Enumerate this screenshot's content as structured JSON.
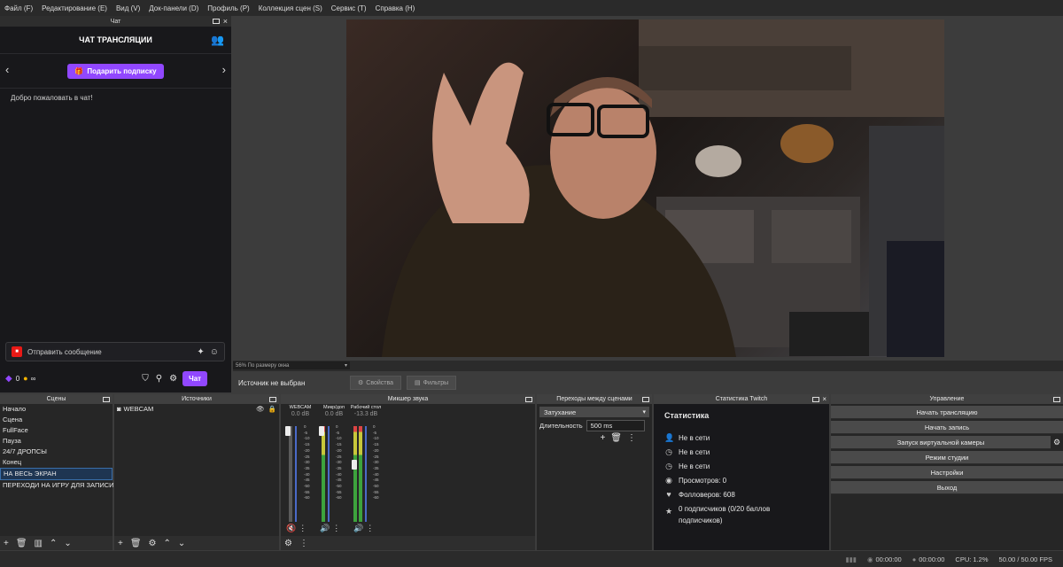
{
  "menu": [
    "Файл (F)",
    "Редактирование (E)",
    "Вид (V)",
    "Док-панели (D)",
    "Профиль (P)",
    "Коллекция сцен (S)",
    "Сервис (T)",
    "Справка (H)"
  ],
  "chat_dock": {
    "dock_title": "Чат",
    "header": "ЧАТ ТРАНСЛЯЦИИ",
    "gift_button": "Подарить подписку",
    "welcome": "Добро пожаловать в чат!",
    "message_placeholder": "Отправить сообщение",
    "points": "0",
    "infinity": "∞",
    "send_button": "Чат"
  },
  "preview": {
    "zoom_label": "56% По размеру окна"
  },
  "source_bar": {
    "label": "Источник не выбран",
    "properties": "Свойства",
    "filters": "Фильтры"
  },
  "scenes": {
    "title": "Сцены",
    "items": [
      "Начало",
      "Сцена",
      "FullFace",
      "Пауза",
      "24/7 ДРОПСЫ",
      "Конец",
      "НА ВЕСЬ ЭКРАН",
      "ПЕРЕХОДИ НА ИГРУ ДЛЯ ЗАПИСИ"
    ],
    "selected_index": 6
  },
  "sources": {
    "title": "Источники",
    "items": [
      "WEBCAM"
    ]
  },
  "mixer": {
    "title": "Микшер звука",
    "channels": [
      {
        "name": "WEBCAM",
        "db": "0.0 dB",
        "muted": true,
        "level": 0.0
      },
      {
        "name": "Микр/доп",
        "db": "0.0 dB",
        "muted": false,
        "level": 0.3
      },
      {
        "name": "Рабочий стол",
        "db": "-13.3 dB",
        "muted": false,
        "level": 0.25
      }
    ],
    "scale": [
      "0",
      "-5",
      "-10",
      "-15",
      "-20",
      "-25",
      "-30",
      "-35",
      "-40",
      "-45",
      "-50",
      "-55",
      "-60"
    ]
  },
  "transitions": {
    "title": "Переходы между сценами",
    "selected": "Затухание",
    "duration_label": "Длительность",
    "duration_value": "500 ms"
  },
  "twitch_stats": {
    "title": "Статистика Twitch",
    "heading": "Статистика",
    "rows": [
      "Не в сети",
      "Не в сети",
      "Не в сети",
      "Просмотров: 0",
      "Фолловеров: 608",
      "0 подписчиков (0/20 баллов подписчиков)"
    ]
  },
  "controls": {
    "title": "Управление",
    "buttons": [
      "Начать трансляцию",
      "Начать запись",
      "Запуск виртуальной камеры",
      "Режим студии",
      "Настройки",
      "Выход"
    ]
  },
  "status": {
    "stream_time": "00:00:00",
    "rec_time": "00:00:00",
    "cpu": "CPU: 1.2%",
    "fps": "50.00 / 50.00 FPS"
  },
  "colors": {
    "twitch_purple": "#9147ff",
    "panel": "#262626",
    "header": "#404040"
  }
}
